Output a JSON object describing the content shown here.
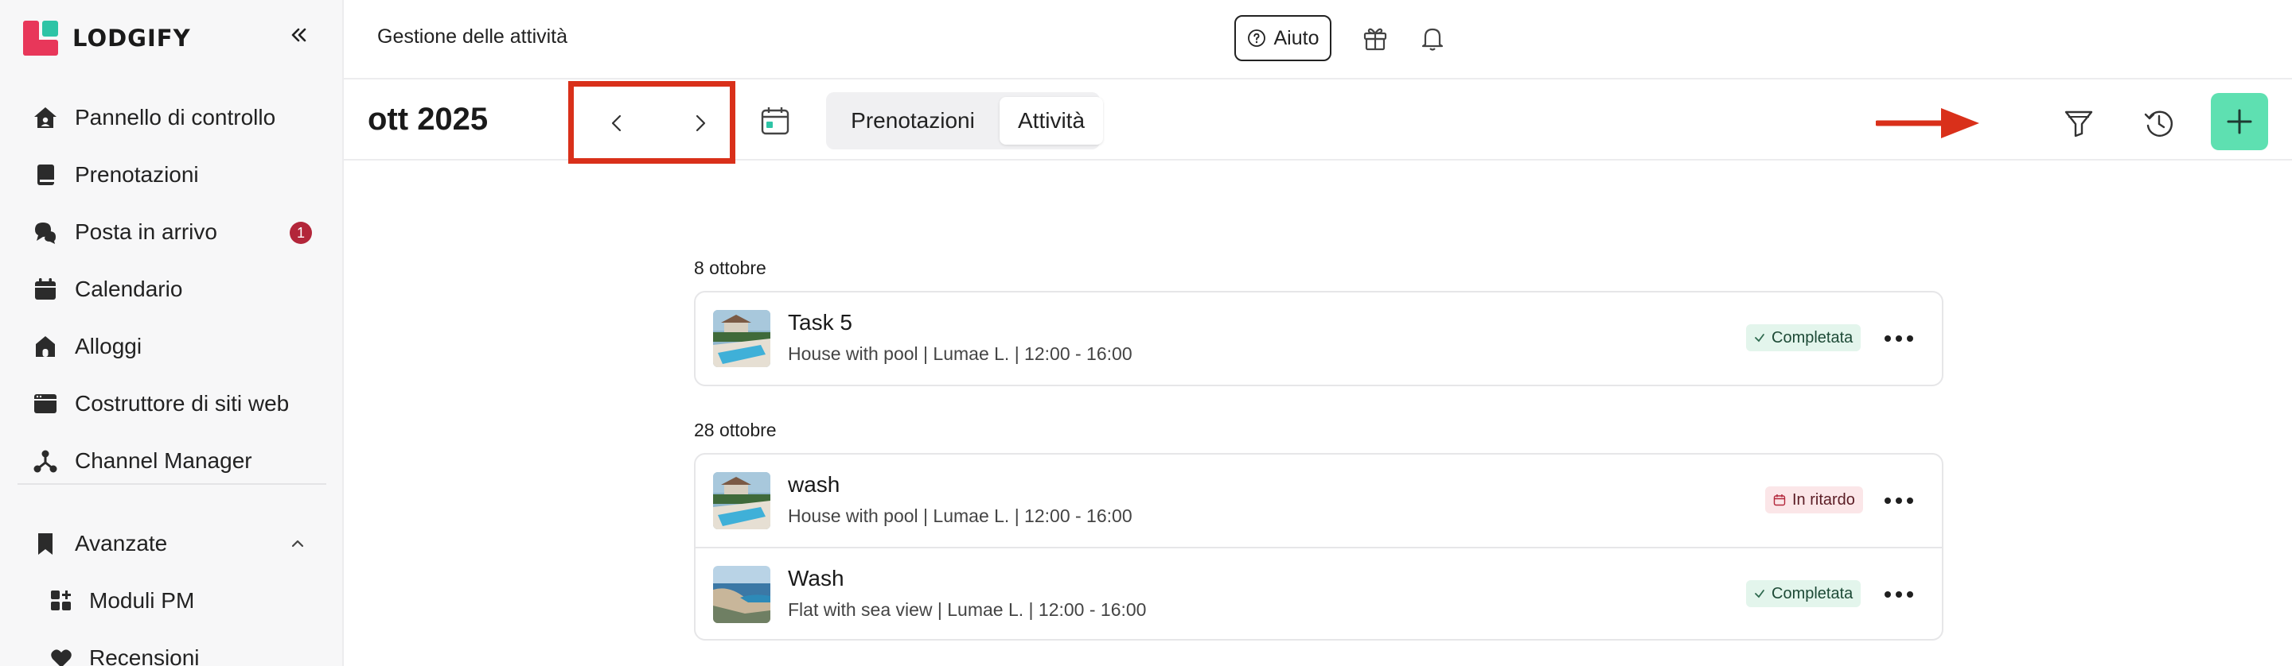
{
  "brand": {
    "name": "LODGIFY"
  },
  "sidebar": {
    "items": [
      {
        "label": "Pannello di controllo",
        "icon": "home-icon"
      },
      {
        "label": "Prenotazioni",
        "icon": "book-icon"
      },
      {
        "label": "Posta in arrivo",
        "icon": "chat-icon",
        "badge": "1"
      },
      {
        "label": "Calendario",
        "icon": "calendar-icon"
      },
      {
        "label": "Alloggi",
        "icon": "house-icon"
      },
      {
        "label": "Costruttore di siti web",
        "icon": "browser-icon"
      },
      {
        "label": "Channel Manager",
        "icon": "network-icon"
      }
    ],
    "section": {
      "label": "Avanzate",
      "icon": "bookmark-icon",
      "expanded": true
    },
    "sub_items": [
      {
        "label": "Moduli PM",
        "icon": "modules-icon"
      },
      {
        "label": "Recensioni",
        "icon": "heart-icon"
      }
    ]
  },
  "header": {
    "title": "Gestione delle attività",
    "help_label": "Aiuto"
  },
  "toolbar": {
    "month": "ott 2025",
    "tabs": [
      {
        "label": "Prenotazioni",
        "active": false
      },
      {
        "label": "Attività",
        "active": true
      }
    ]
  },
  "groups": [
    {
      "date": "8 ottobre",
      "tasks": [
        {
          "title": "Task 5",
          "subtitle": "House with pool | Lumae L. | 12:00 - 16:00",
          "status": "Completata",
          "status_type": "done",
          "thumb": "pool"
        }
      ]
    },
    {
      "date": "28 ottobre",
      "tasks": [
        {
          "title": "wash",
          "subtitle": "House with pool | Lumae L. | 12:00 - 16:00",
          "status": "In ritardo",
          "status_type": "late",
          "thumb": "pool"
        },
        {
          "title": "Wash",
          "subtitle": "Flat with sea view | Lumae L. | 12:00 - 16:00",
          "status": "Completata",
          "status_type": "done",
          "thumb": "sea"
        }
      ]
    }
  ],
  "colors": {
    "accent": "#5ee0b1",
    "brand_red": "#e8375a",
    "brand_green": "#2ec4a6",
    "badge": "#b3263a",
    "highlight": "#d9301a"
  }
}
